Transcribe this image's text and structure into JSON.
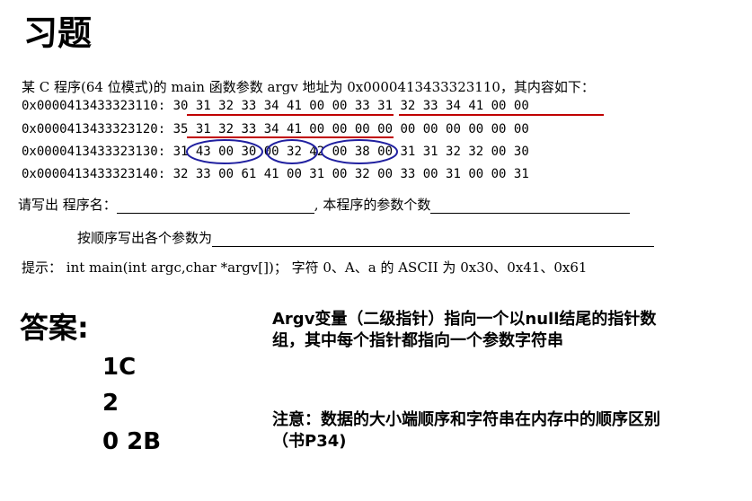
{
  "title": "习题",
  "intro": "某 C 程序(64 位模式)的 main 函数参数 argv 地址为 0x0000413433323110，其内容如下：",
  "memory": [
    {
      "addr": "0x0000413433323110:",
      "bytes": "30 31 32 33 34 41 00 00 33 31 32 33 34 41 00 00"
    },
    {
      "addr": "0x0000413433323120:",
      "bytes": "35 31 32 33 34 41 00 00 00 00 00 00 00 00 00 00"
    },
    {
      "addr": "0x0000413433323130:",
      "bytes": "31 43 00 30 00 32 42 00 38 00 31 31 32 32 00 30"
    },
    {
      "addr": "0x0000413433323140:",
      "bytes": "32 33 00 61 41 00 31 00 32 00 33 00 31 00 00 31"
    }
  ],
  "question1": {
    "label": "请写出  程序名：",
    "middle": ", 本程序的参数个数"
  },
  "question2": {
    "label": "按顺序写出各个参数为"
  },
  "hint": "提示：  int main(int argc,char *argv[])； 字符 0、A、a 的 ASCII 为 0x30、0x41、0x61",
  "answer": {
    "label": "答案:",
    "values": [
      "1C",
      "2",
      "0 2B"
    ]
  },
  "notes": {
    "note1": "Argv变量（二级指针）指向一个以null结尾的指针数组，其中每个指针都指向一个参数字符串",
    "note2": "注意：数据的大小端顺序和字符串在内存中的顺序区别（书P34)"
  },
  "colors": {
    "underline": "#c00000",
    "circle": "#2020a0"
  }
}
